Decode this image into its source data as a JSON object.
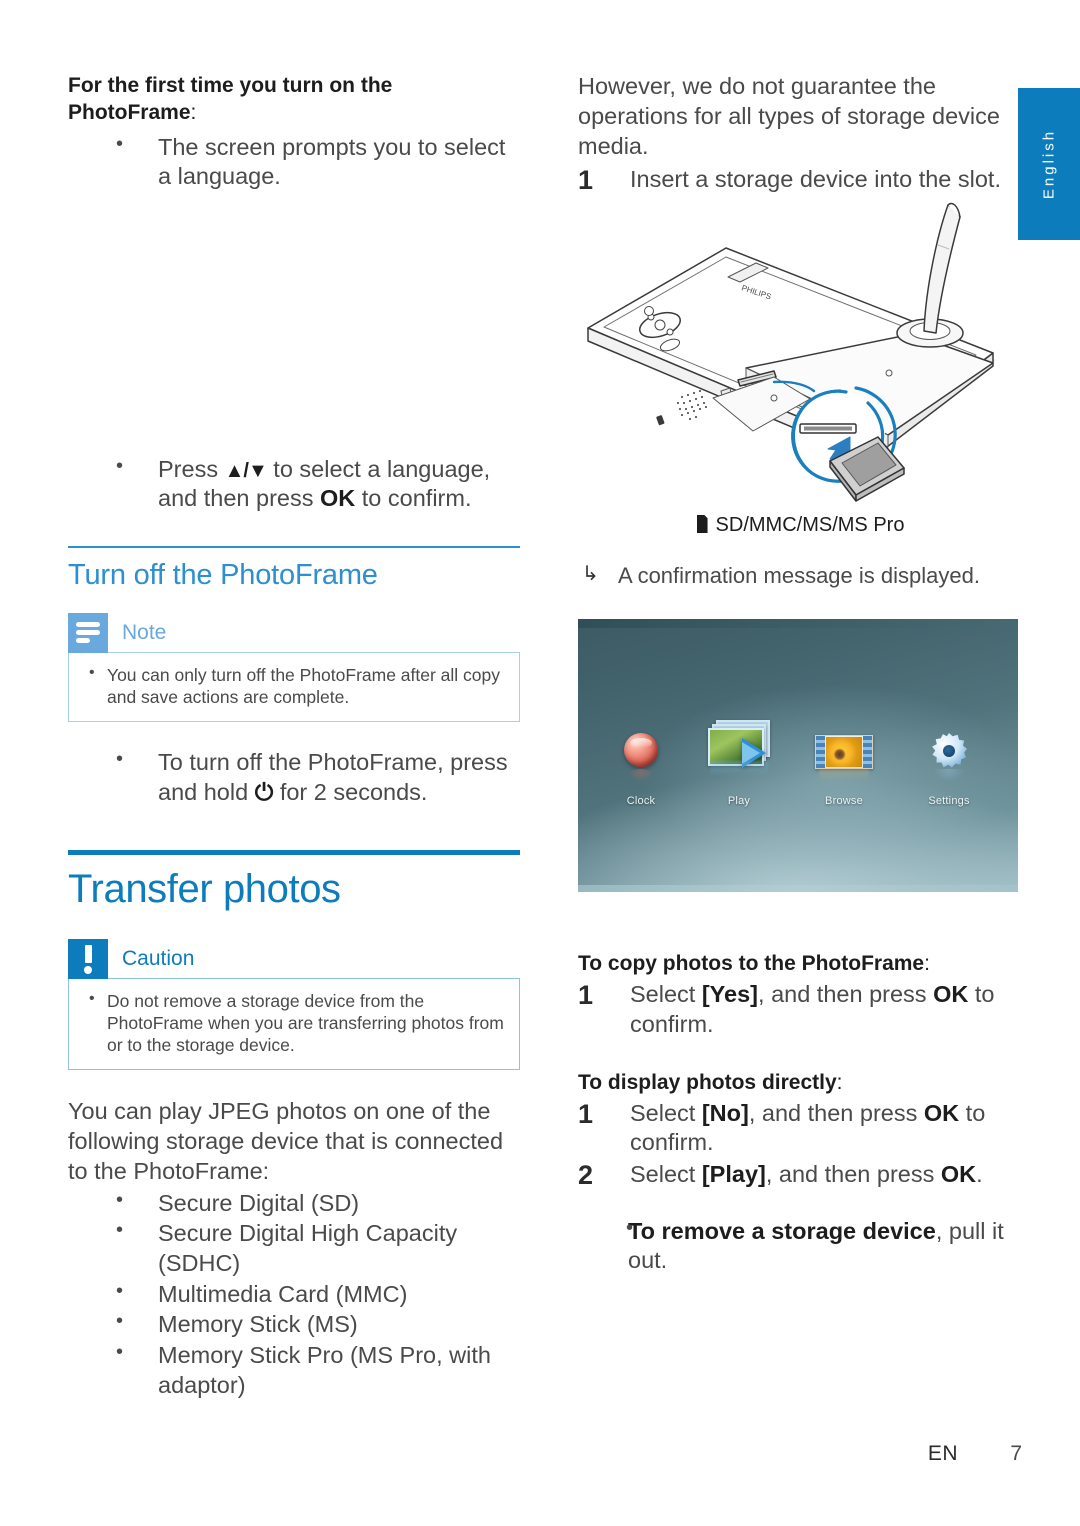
{
  "page": {
    "language_tab": "English",
    "footer_locale": "EN",
    "footer_page_number": "7",
    "accent_blue": "#0d7cbd",
    "heading_blue": "#2d8fd0",
    "note_blue": "#6aa9dd"
  },
  "left_column": {
    "first_time_heading": "For the first time you turn on the",
    "first_time_heading_line2": "PhotoFrame",
    "first_time_heading_colon": ":",
    "first_bullets": [
      "The screen prompts you to select a language."
    ],
    "language_bullet_prefix": "Press ",
    "language_bullet_keys": "▲/▼",
    "language_bullet_mid": " to select a language, and then press ",
    "language_bullet_ok": "OK",
    "language_bullet_suffix": " to confirm.",
    "turn_off_heading": "Turn off the PhotoFrame",
    "note": {
      "title": "Note",
      "icon": "note-lines-icon",
      "items": [
        "You can only turn off the PhotoFrame after all copy and save actions are complete."
      ]
    },
    "turn_off_bullet_prefix": "To turn off the PhotoFrame, press and hold ",
    "turn_off_bullet_symbol": "⏻",
    "turn_off_bullet_suffix": " for 2 seconds.",
    "chapter_heading": "Transfer photos",
    "caution": {
      "title": "Caution",
      "icon": "exclamation-icon",
      "items": [
        "Do not remove a storage device from the PhotoFrame when you are transferring photos from or to the storage device."
      ]
    },
    "jpeg_paragraph": "You can play JPEG photos on one of the following storage device that is connected to the PhotoFrame:",
    "storage_devices": [
      "Secure Digital (SD)",
      "Secure Digital High Capacity (SDHC)",
      "Multimedia Card (MMC)",
      "Memory Stick (MS)",
      "Memory Stick Pro (MS Pro, with adaptor)"
    ]
  },
  "right_column": {
    "intro_paragraph": "However, we do not guarantee the operations for all types of storage device media.",
    "insert_step_number": "1",
    "insert_step_text": "Insert a storage device into the slot.",
    "illustration_name": "photoframe-back-sd-insert-illustration",
    "slot_caption": "SD/MMC/MS/MS Pro",
    "confirmation_arrow": "↳",
    "confirmation_text": "A confirmation message is displayed.",
    "device_screen": {
      "name": "photoframe-home-menu-screenshot",
      "menu_items": [
        {
          "label": "Clock",
          "icon": "clock-ball-icon"
        },
        {
          "label": "Play",
          "icon": "play-photos-icon"
        },
        {
          "label": "Browse",
          "icon": "browse-filmstrip-icon"
        },
        {
          "label": "Settings",
          "icon": "gear-icon"
        }
      ]
    },
    "copy_heading": "To copy photos to the PhotoFrame",
    "copy_heading_colon": ":",
    "copy_steps": [
      {
        "number": "1",
        "prefix": "Select ",
        "bracket": "[Yes]",
        "mid": ", and then press ",
        "key": "OK",
        "suffix": " to confirm."
      }
    ],
    "display_heading": "To display photos directly",
    "display_heading_colon": ":",
    "display_steps": [
      {
        "number": "1",
        "prefix": "Select ",
        "bracket": "[No]",
        "mid": ", and then press ",
        "key": "OK",
        "suffix": " to confirm."
      },
      {
        "number": "2",
        "prefix": "Select ",
        "bracket": "[Play]",
        "mid": ", and then press ",
        "key": "OK",
        "suffix": "."
      }
    ],
    "remove_bullet_bold": "To remove a storage device",
    "remove_bullet_rest": ", pull it out."
  }
}
